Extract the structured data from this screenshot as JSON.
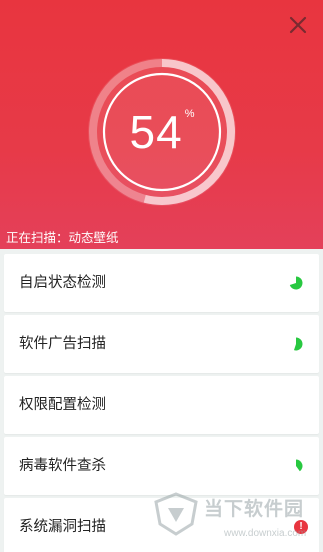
{
  "header": {
    "bg_color": "#e8353f",
    "close_icon": "close-icon"
  },
  "gauge": {
    "progress_percent": 54,
    "value": "54",
    "unit": "%"
  },
  "scan_status": "正在扫描：动态壁纸",
  "checks": [
    {
      "label": "自启状态检测",
      "indicator": "pie-progress-icon",
      "progress": 0.7,
      "color": "#28c840"
    },
    {
      "label": "软件广告扫描",
      "indicator": "pie-progress-icon",
      "progress": 0.55,
      "color": "#28c840"
    },
    {
      "label": "权限配置检测",
      "indicator": "none",
      "progress": 0,
      "color": "#28c840"
    },
    {
      "label": "病毒软件查杀",
      "indicator": "pie-progress-icon",
      "progress": 0.4,
      "color": "#28c840"
    },
    {
      "label": "系统漏洞扫描",
      "indicator": "alert-icon",
      "progress": 0,
      "color": "#e8353f"
    }
  ],
  "alert_symbol": "!",
  "watermark": {
    "title": "当下软件园",
    "url": "www.downxia.com"
  }
}
